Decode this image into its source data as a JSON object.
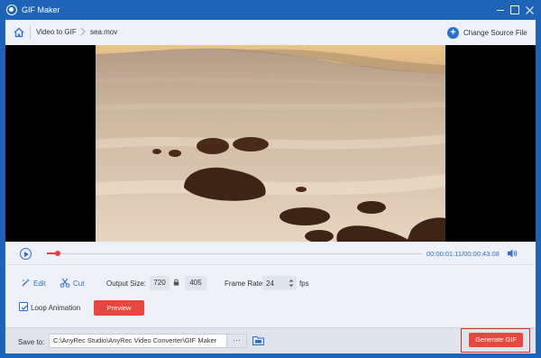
{
  "window": {
    "title": "GIF Maker",
    "accent": "#1e63b8"
  },
  "breadcrumb": {
    "section": "Video to GIF",
    "file": "sea.mov",
    "change_source_label": "Change Source File"
  },
  "player": {
    "current_time": "00:00:01.11",
    "separator": "/",
    "total_time": "00:00:43.08",
    "progress": 0.03
  },
  "tools": {
    "edit_label": "Edit",
    "cut_label": "Cut"
  },
  "output": {
    "size_label": "Output Size:",
    "width": "720",
    "height": "405",
    "frame_rate_label": "Frame Rate:",
    "frame_rate": "24",
    "fps_unit": "fps"
  },
  "options": {
    "loop_label": "Loop Animation",
    "loop_checked": true,
    "preview_label": "Preview"
  },
  "save": {
    "label": "Save to:",
    "path": "C:\\AnyRec Studio\\AnyRec Video Converter\\GIF Maker",
    "browse_label": "···",
    "generate_label": "Generate GIF"
  },
  "colors": {
    "primary_button": "#e8473f",
    "link_blue": "#2a6fd6",
    "highlight_outline": "#c9362f"
  },
  "icons": [
    "app-logo-icon",
    "minimize-icon",
    "maximize-icon",
    "close-icon",
    "home-icon",
    "chevron-right-icon",
    "plus-circle-icon",
    "play-icon",
    "volume-icon",
    "edit-icon",
    "scissors-icon",
    "lock-icon",
    "spinner-icon",
    "checkbox-icon",
    "folder-icon"
  ]
}
